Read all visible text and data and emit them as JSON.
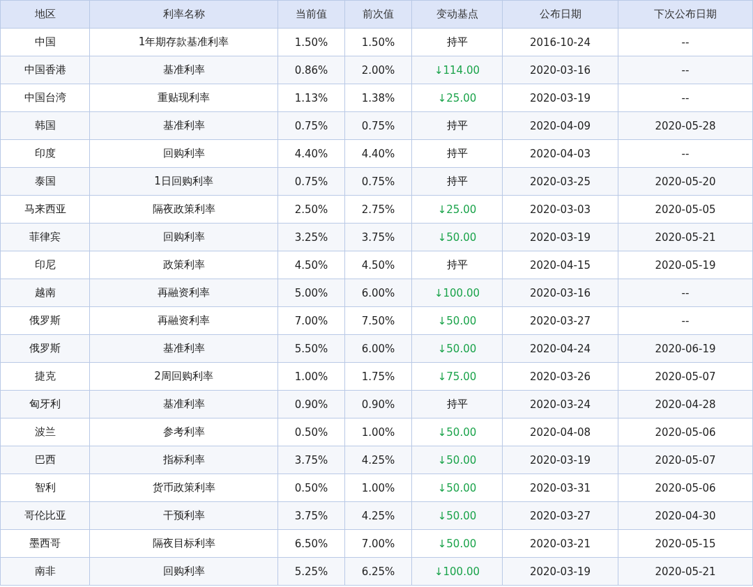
{
  "table": {
    "columns": [
      "地区",
      "利率名称",
      "当前值",
      "前次值",
      "变动基点",
      "公布日期",
      "下次公布日期"
    ],
    "rows": [
      {
        "cells": [
          "中国",
          "1年期存款基准利率",
          "1.50%",
          "1.50%",
          "持平",
          "2016-10-24",
          "--"
        ],
        "kind": "flat"
      },
      {
        "cells": [
          "中国香港",
          "基准利率",
          "0.86%",
          "2.00%",
          "↓114.00",
          "2020-03-16",
          "--"
        ],
        "kind": "down"
      },
      {
        "cells": [
          "中国台湾",
          "重贴现利率",
          "1.13%",
          "1.38%",
          "↓25.00",
          "2020-03-19",
          "--"
        ],
        "kind": "down"
      },
      {
        "cells": [
          "韩国",
          "基准利率",
          "0.75%",
          "0.75%",
          "持平",
          "2020-04-09",
          "2020-05-28"
        ],
        "kind": "flat"
      },
      {
        "cells": [
          "印度",
          "回购利率",
          "4.40%",
          "4.40%",
          "持平",
          "2020-04-03",
          "--"
        ],
        "kind": "flat"
      },
      {
        "cells": [
          "泰国",
          "1日回购利率",
          "0.75%",
          "0.75%",
          "持平",
          "2020-03-25",
          "2020-05-20"
        ],
        "kind": "flat"
      },
      {
        "cells": [
          "马来西亚",
          "隔夜政策利率",
          "2.50%",
          "2.75%",
          "↓25.00",
          "2020-03-03",
          "2020-05-05"
        ],
        "kind": "down"
      },
      {
        "cells": [
          "菲律宾",
          "回购利率",
          "3.25%",
          "3.75%",
          "↓50.00",
          "2020-03-19",
          "2020-05-21"
        ],
        "kind": "down"
      },
      {
        "cells": [
          "印尼",
          "政策利率",
          "4.50%",
          "4.50%",
          "持平",
          "2020-04-15",
          "2020-05-19"
        ],
        "kind": "flat"
      },
      {
        "cells": [
          "越南",
          "再融资利率",
          "5.00%",
          "6.00%",
          "↓100.00",
          "2020-03-16",
          "--"
        ],
        "kind": "down"
      },
      {
        "cells": [
          "俄罗斯",
          "再融资利率",
          "7.00%",
          "7.50%",
          "↓50.00",
          "2020-03-27",
          "--"
        ],
        "kind": "down"
      },
      {
        "cells": [
          "俄罗斯",
          "基准利率",
          "5.50%",
          "6.00%",
          "↓50.00",
          "2020-04-24",
          "2020-06-19"
        ],
        "kind": "down"
      },
      {
        "cells": [
          "捷克",
          "2周回购利率",
          "1.00%",
          "1.75%",
          "↓75.00",
          "2020-03-26",
          "2020-05-07"
        ],
        "kind": "down"
      },
      {
        "cells": [
          "匈牙利",
          "基准利率",
          "0.90%",
          "0.90%",
          "持平",
          "2020-03-24",
          "2020-04-28"
        ],
        "kind": "flat"
      },
      {
        "cells": [
          "波兰",
          "参考利率",
          "0.50%",
          "1.00%",
          "↓50.00",
          "2020-04-08",
          "2020-05-06"
        ],
        "kind": "down"
      },
      {
        "cells": [
          "巴西",
          "指标利率",
          "3.75%",
          "4.25%",
          "↓50.00",
          "2020-03-19",
          "2020-05-07"
        ],
        "kind": "down"
      },
      {
        "cells": [
          "智利",
          "货币政策利率",
          "0.50%",
          "1.00%",
          "↓50.00",
          "2020-03-31",
          "2020-05-06"
        ],
        "kind": "down"
      },
      {
        "cells": [
          "哥伦比亚",
          "干预利率",
          "3.75%",
          "4.25%",
          "↓50.00",
          "2020-03-27",
          "2020-04-30"
        ],
        "kind": "down"
      },
      {
        "cells": [
          "墨西哥",
          "隔夜目标利率",
          "6.50%",
          "7.00%",
          "↓50.00",
          "2020-03-21",
          "2020-05-15"
        ],
        "kind": "down"
      },
      {
        "cells": [
          "南非",
          "回购利率",
          "5.25%",
          "6.25%",
          "↓100.00",
          "2020-03-19",
          "2020-05-21"
        ],
        "kind": "down"
      }
    ]
  }
}
